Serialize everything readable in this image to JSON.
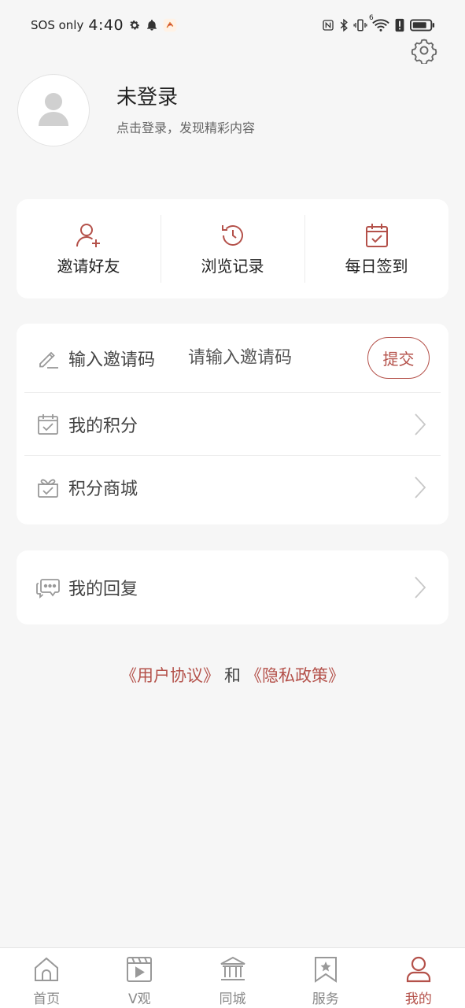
{
  "status_bar": {
    "carrier": "SOS only",
    "time": "4:40",
    "icons_left": [
      "gear-icon",
      "bell-icon",
      "app-notification-icon"
    ],
    "icons_right": [
      "nfc-icon",
      "bluetooth-icon",
      "vibrate-icon",
      "wifi-icon",
      "alert-icon",
      "battery-icon"
    ],
    "wifi_badge": "6"
  },
  "profile": {
    "title": "未登录",
    "subtitle": "点击登录，发现精彩内容"
  },
  "quick_actions": [
    {
      "label": "邀请好友",
      "icon": "add-user-icon"
    },
    {
      "label": "浏览记录",
      "icon": "history-icon"
    },
    {
      "label": "每日签到",
      "icon": "calendar-check-icon"
    }
  ],
  "invite": {
    "label": "输入邀请码",
    "placeholder": "请输入邀请码",
    "submit": "提交"
  },
  "menu": [
    {
      "label": "我的积分",
      "icon": "points-icon"
    },
    {
      "label": "积分商城",
      "icon": "gift-icon"
    }
  ],
  "reply": {
    "label": "我的回复",
    "icon": "chat-icon"
  },
  "agreement": {
    "user_agreement": "《用户协议》",
    "and": "和",
    "privacy_policy": "《隐私政策》"
  },
  "bottom_nav": [
    {
      "label": "首页",
      "icon": "home-icon",
      "active": false
    },
    {
      "label": "V观",
      "icon": "video-icon",
      "active": false
    },
    {
      "label": "同城",
      "icon": "building-icon",
      "active": false
    },
    {
      "label": "服务",
      "icon": "star-bookmark-icon",
      "active": false
    },
    {
      "label": "我的",
      "icon": "user-icon",
      "active": true
    }
  ],
  "colors": {
    "accent": "#b4514a",
    "background": "#f6f6f6",
    "card": "#ffffff",
    "icon_gray": "#9a9a9a"
  }
}
